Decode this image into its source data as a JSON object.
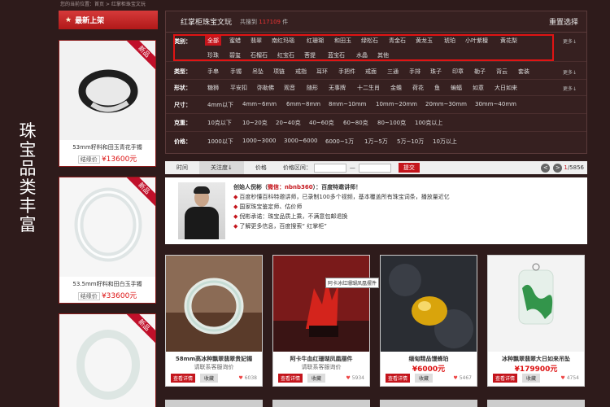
{
  "breadcrumb": "您的当前位置：首页 > 红掌柜珠宝文玩",
  "side_title": "珠宝品类丰富",
  "new_arrivals": {
    "title": "最新上架",
    "badge": "新品",
    "items": [
      {
        "name": "53mm籽料和田玉青花手镯",
        "price_label": "结缘价",
        "price": "¥13600元"
      },
      {
        "name": "53.5mm籽料和田白玉手镯",
        "price_label": "结缘价",
        "price": "¥33600元"
      },
      {
        "name": "",
        "price_label": "",
        "price": ""
      }
    ]
  },
  "filter_panel": {
    "title": "红掌柜珠宝文玩",
    "count_prefix": "共搜到",
    "count": "117109",
    "count_suffix": "件",
    "reset": "重置选择",
    "more": "更多↓",
    "rows": [
      {
        "label": "类别：",
        "options": [
          "全部",
          "蜜蜡",
          "翡翠",
          "南红玛瑙",
          "红珊瑚",
          "和田玉",
          "绿松石",
          "青金石",
          "黄龙玉",
          "琥珀",
          "小叶紫檀",
          "黄花梨"
        ],
        "options2": [
          "珍珠",
          "碧玺",
          "石榴石",
          "红宝石",
          "菩提",
          "蓝宝石",
          "水晶",
          "其他"
        ]
      },
      {
        "label": "类型：",
        "options": [
          "手串",
          "手镯",
          "吊坠",
          "项链",
          "戒指",
          "耳环",
          "手把件",
          "戒面",
          "三通",
          "手排",
          "珠子",
          "印章",
          "勒子",
          "背云",
          "套装"
        ]
      },
      {
        "label": "形状：",
        "options": [
          "糖狮",
          "平安扣",
          "弥勒佛",
          "观音",
          "随形",
          "无事牌",
          "十二生肖",
          "金蟾",
          "荷花",
          "鱼",
          "蝙蝠",
          "如意",
          "大日如来"
        ]
      },
      {
        "label": "尺寸：",
        "options": [
          "4mm以下",
          "4mm~6mm",
          "6mm~8mm",
          "8mm~10mm",
          "10mm~20mm",
          "20mm~30mm",
          "30mm~40mm"
        ]
      },
      {
        "label": "克重：",
        "options": [
          "10克以下",
          "10~20克",
          "20~40克",
          "40~60克",
          "60~80克",
          "80~100克",
          "100克以上"
        ]
      },
      {
        "label": "价格：",
        "options": [
          "1000以下",
          "1000~3000",
          "3000~6000",
          "6000~1万",
          "1万~5万",
          "5万~10万",
          "10万以上"
        ]
      }
    ]
  },
  "sort_bar": {
    "time": "时间",
    "popularity": "关注度↓",
    "price": "价格",
    "range_label": "价格区间：",
    "dash": "—",
    "submit": "提交",
    "page_current": "1",
    "page_total": "/5856",
    "prev": "<",
    "next": ">"
  },
  "promo": {
    "line0_prefix": "创始人倪彬（",
    "line0_wechat": "微信：nbnb360",
    "line0_suffix": "）：百度特邀讲师！",
    "bullets": [
      "百度秒懂百科特邀讲师，已录制100多个视频，基本覆盖所有珠宝词条，播放量近亿",
      "国家珠宝鉴定师、估价师",
      "倪彬承诺：珠宝品质上乘，不满意包邮退换",
      "了解更多信息，百度搜索“ 红掌柜”"
    ]
  },
  "tooltip": "阿卡冰红珊瑚凤凰摆件",
  "products": [
    {
      "name": "58mm高冰种飘翠翡翠贵妃镯",
      "ask": "请联系客服询价",
      "price": "",
      "view": "查看详情",
      "fav": "收藏",
      "likes": "6038"
    },
    {
      "name": "阿卡牛血红珊瑚凤凰摆件",
      "ask": "请联系客服询价",
      "price": "",
      "view": "查看详情",
      "fav": "收藏",
      "likes": "5934"
    },
    {
      "name": "缅甸精品馒蜂珀",
      "ask": "",
      "price": "¥6000元",
      "view": "查看详情",
      "fav": "收藏",
      "likes": "5467"
    },
    {
      "name": "冰种飘翠翡翠大日如来吊坠",
      "ask": "",
      "price": "¥179900元",
      "view": "查看详情",
      "fav": "收藏",
      "likes": "4754"
    }
  ],
  "colors": {
    "accent": "#c4151c",
    "background": "#2e1b1b",
    "panel": "#362020"
  },
  "icons": [
    "star-icon",
    "heart-icon",
    "chevron-left-icon",
    "chevron-right-icon"
  ]
}
